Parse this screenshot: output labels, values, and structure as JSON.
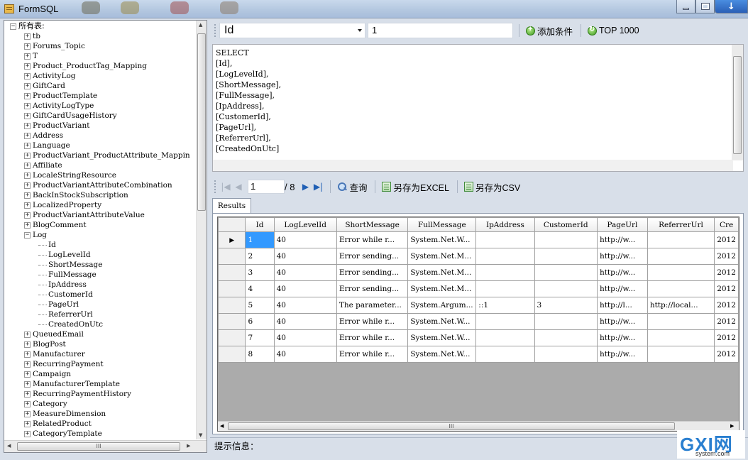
{
  "window": {
    "title": "FormSQL"
  },
  "tree": {
    "root": "所有表:",
    "items": [
      {
        "label": "tb",
        "toggle": "+",
        "level": 1
      },
      {
        "label": "Forums_Topic",
        "toggle": "+",
        "level": 1
      },
      {
        "label": "T",
        "toggle": "+",
        "level": 1
      },
      {
        "label": "Product_ProductTag_Mapping",
        "toggle": "+",
        "level": 1
      },
      {
        "label": "ActivityLog",
        "toggle": "+",
        "level": 1
      },
      {
        "label": "GiftCard",
        "toggle": "+",
        "level": 1
      },
      {
        "label": "ProductTemplate",
        "toggle": "+",
        "level": 1
      },
      {
        "label": "ActivityLogType",
        "toggle": "+",
        "level": 1
      },
      {
        "label": "GiftCardUsageHistory",
        "toggle": "+",
        "level": 1
      },
      {
        "label": "ProductVariant",
        "toggle": "+",
        "level": 1
      },
      {
        "label": "Address",
        "toggle": "+",
        "level": 1
      },
      {
        "label": "Language",
        "toggle": "+",
        "level": 1
      },
      {
        "label": "ProductVariant_ProductAttribute_Mappin",
        "toggle": "+",
        "level": 1
      },
      {
        "label": "Affiliate",
        "toggle": "+",
        "level": 1
      },
      {
        "label": "LocaleStringResource",
        "toggle": "+",
        "level": 1
      },
      {
        "label": "ProductVariantAttributeCombination",
        "toggle": "+",
        "level": 1
      },
      {
        "label": "BackInStockSubscription",
        "toggle": "+",
        "level": 1
      },
      {
        "label": "LocalizedProperty",
        "toggle": "+",
        "level": 1
      },
      {
        "label": "ProductVariantAttributeValue",
        "toggle": "+",
        "level": 1
      },
      {
        "label": "BlogComment",
        "toggle": "+",
        "level": 1
      },
      {
        "label": "Log",
        "toggle": "−",
        "level": 1
      },
      {
        "label": "Id",
        "toggle": "",
        "level": 2
      },
      {
        "label": "LogLevelId",
        "toggle": "",
        "level": 2
      },
      {
        "label": "ShortMessage",
        "toggle": "",
        "level": 2
      },
      {
        "label": "FullMessage",
        "toggle": "",
        "level": 2
      },
      {
        "label": "IpAddress",
        "toggle": "",
        "level": 2
      },
      {
        "label": "CustomerId",
        "toggle": "",
        "level": 2
      },
      {
        "label": "PageUrl",
        "toggle": "",
        "level": 2
      },
      {
        "label": "ReferrerUrl",
        "toggle": "",
        "level": 2
      },
      {
        "label": "CreatedOnUtc",
        "toggle": "",
        "level": 2
      },
      {
        "label": "QueuedEmail",
        "toggle": "+",
        "level": 1
      },
      {
        "label": "BlogPost",
        "toggle": "+",
        "level": 1
      },
      {
        "label": "Manufacturer",
        "toggle": "+",
        "level": 1
      },
      {
        "label": "RecurringPayment",
        "toggle": "+",
        "level": 1
      },
      {
        "label": "Campaign",
        "toggle": "+",
        "level": 1
      },
      {
        "label": "ManufacturerTemplate",
        "toggle": "+",
        "level": 1
      },
      {
        "label": "RecurringPaymentHistory",
        "toggle": "+",
        "level": 1
      },
      {
        "label": "Category",
        "toggle": "+",
        "level": 1
      },
      {
        "label": "MeasureDimension",
        "toggle": "+",
        "level": 1
      },
      {
        "label": "RelatedProduct",
        "toggle": "+",
        "level": 1
      },
      {
        "label": "CategoryTemplate",
        "toggle": "+",
        "level": 1
      }
    ]
  },
  "toolbar": {
    "field_select": "Id",
    "value_input": "1",
    "add_condition": "添加条件",
    "top1000": "TOP 1000"
  },
  "sql": {
    "text": "SELECT\n[Id],\n[LogLevelId],\n[ShortMessage],\n[FullMessage],\n[IpAddress],\n[CustomerId],\n[PageUrl],\n[ReferrerUrl],\n[CreatedOnUtc]"
  },
  "pager": {
    "current_page": "1",
    "total": "/ 8",
    "query": "查询",
    "save_excel": "另存为EXCEL",
    "save_csv": "另存为CSV"
  },
  "results_tab": "Results",
  "grid": {
    "columns": [
      "Id",
      "LogLevelId",
      "ShortMessage",
      "FullMessage",
      "IpAddress",
      "CustomerId",
      "PageUrl",
      "ReferrerUrl",
      "Cre"
    ],
    "rows": [
      [
        "1",
        "40",
        "Error while r...",
        "System.Net.W...",
        "",
        "",
        "http://w...",
        "",
        "2012"
      ],
      [
        "2",
        "40",
        "Error sending...",
        "System.Net.M...",
        "",
        "",
        "http://w...",
        "",
        "2012"
      ],
      [
        "3",
        "40",
        "Error sending...",
        "System.Net.M...",
        "",
        "",
        "http://w...",
        "",
        "2012"
      ],
      [
        "4",
        "40",
        "Error sending...",
        "System.Net.M...",
        "",
        "",
        "http://w...",
        "",
        "2012"
      ],
      [
        "5",
        "40",
        "The parameter...",
        "System.Argum...",
        "::1",
        "3",
        "http://l...",
        "http://local...",
        "2012"
      ],
      [
        "6",
        "40",
        "Error while r...",
        "System.Net.W...",
        "",
        "",
        "http://w...",
        "",
        "2012"
      ],
      [
        "7",
        "40",
        "Error while r...",
        "System.Net.W...",
        "",
        "",
        "http://w...",
        "",
        "2012"
      ],
      [
        "8",
        "40",
        "Error while r...",
        "System.Net.W...",
        "",
        "",
        "http://w...",
        "",
        "2012"
      ]
    ]
  },
  "status": {
    "label": "提示信息："
  },
  "watermark": {
    "brand": "GXI网",
    "site": "system.com"
  },
  "colors": {
    "selection": "#3399ff",
    "titlebar": "#b4c8e0",
    "close_button": "#2a5fb6"
  }
}
